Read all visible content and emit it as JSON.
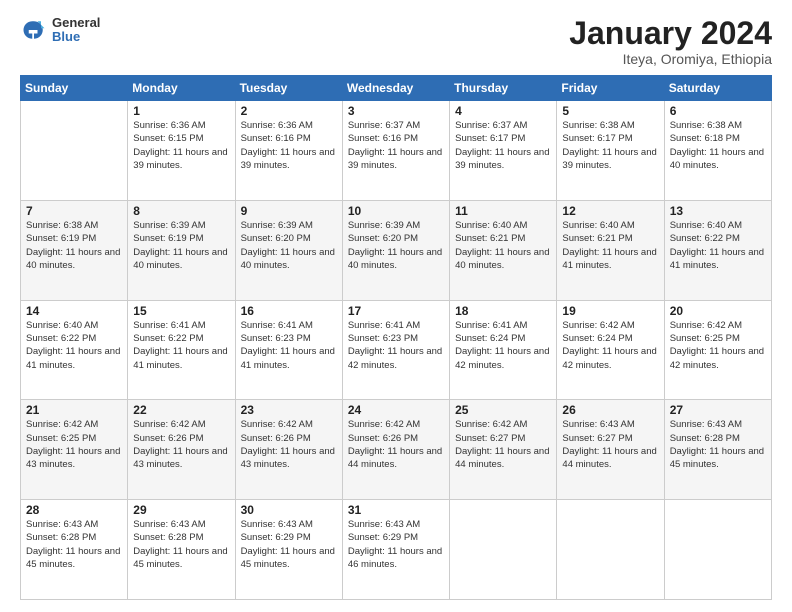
{
  "header": {
    "logo_general": "General",
    "logo_blue": "Blue",
    "month_title": "January 2024",
    "subtitle": "Iteya, Oromiya, Ethiopia"
  },
  "days_of_week": [
    "Sunday",
    "Monday",
    "Tuesday",
    "Wednesday",
    "Thursday",
    "Friday",
    "Saturday"
  ],
  "weeks": [
    [
      {
        "num": "",
        "sunrise": "",
        "sunset": "",
        "daylight": ""
      },
      {
        "num": "1",
        "sunrise": "Sunrise: 6:36 AM",
        "sunset": "Sunset: 6:15 PM",
        "daylight": "Daylight: 11 hours and 39 minutes."
      },
      {
        "num": "2",
        "sunrise": "Sunrise: 6:36 AM",
        "sunset": "Sunset: 6:16 PM",
        "daylight": "Daylight: 11 hours and 39 minutes."
      },
      {
        "num": "3",
        "sunrise": "Sunrise: 6:37 AM",
        "sunset": "Sunset: 6:16 PM",
        "daylight": "Daylight: 11 hours and 39 minutes."
      },
      {
        "num": "4",
        "sunrise": "Sunrise: 6:37 AM",
        "sunset": "Sunset: 6:17 PM",
        "daylight": "Daylight: 11 hours and 39 minutes."
      },
      {
        "num": "5",
        "sunrise": "Sunrise: 6:38 AM",
        "sunset": "Sunset: 6:17 PM",
        "daylight": "Daylight: 11 hours and 39 minutes."
      },
      {
        "num": "6",
        "sunrise": "Sunrise: 6:38 AM",
        "sunset": "Sunset: 6:18 PM",
        "daylight": "Daylight: 11 hours and 40 minutes."
      }
    ],
    [
      {
        "num": "7",
        "sunrise": "Sunrise: 6:38 AM",
        "sunset": "Sunset: 6:19 PM",
        "daylight": "Daylight: 11 hours and 40 minutes."
      },
      {
        "num": "8",
        "sunrise": "Sunrise: 6:39 AM",
        "sunset": "Sunset: 6:19 PM",
        "daylight": "Daylight: 11 hours and 40 minutes."
      },
      {
        "num": "9",
        "sunrise": "Sunrise: 6:39 AM",
        "sunset": "Sunset: 6:20 PM",
        "daylight": "Daylight: 11 hours and 40 minutes."
      },
      {
        "num": "10",
        "sunrise": "Sunrise: 6:39 AM",
        "sunset": "Sunset: 6:20 PM",
        "daylight": "Daylight: 11 hours and 40 minutes."
      },
      {
        "num": "11",
        "sunrise": "Sunrise: 6:40 AM",
        "sunset": "Sunset: 6:21 PM",
        "daylight": "Daylight: 11 hours and 40 minutes."
      },
      {
        "num": "12",
        "sunrise": "Sunrise: 6:40 AM",
        "sunset": "Sunset: 6:21 PM",
        "daylight": "Daylight: 11 hours and 41 minutes."
      },
      {
        "num": "13",
        "sunrise": "Sunrise: 6:40 AM",
        "sunset": "Sunset: 6:22 PM",
        "daylight": "Daylight: 11 hours and 41 minutes."
      }
    ],
    [
      {
        "num": "14",
        "sunrise": "Sunrise: 6:40 AM",
        "sunset": "Sunset: 6:22 PM",
        "daylight": "Daylight: 11 hours and 41 minutes."
      },
      {
        "num": "15",
        "sunrise": "Sunrise: 6:41 AM",
        "sunset": "Sunset: 6:22 PM",
        "daylight": "Daylight: 11 hours and 41 minutes."
      },
      {
        "num": "16",
        "sunrise": "Sunrise: 6:41 AM",
        "sunset": "Sunset: 6:23 PM",
        "daylight": "Daylight: 11 hours and 41 minutes."
      },
      {
        "num": "17",
        "sunrise": "Sunrise: 6:41 AM",
        "sunset": "Sunset: 6:23 PM",
        "daylight": "Daylight: 11 hours and 42 minutes."
      },
      {
        "num": "18",
        "sunrise": "Sunrise: 6:41 AM",
        "sunset": "Sunset: 6:24 PM",
        "daylight": "Daylight: 11 hours and 42 minutes."
      },
      {
        "num": "19",
        "sunrise": "Sunrise: 6:42 AM",
        "sunset": "Sunset: 6:24 PM",
        "daylight": "Daylight: 11 hours and 42 minutes."
      },
      {
        "num": "20",
        "sunrise": "Sunrise: 6:42 AM",
        "sunset": "Sunset: 6:25 PM",
        "daylight": "Daylight: 11 hours and 42 minutes."
      }
    ],
    [
      {
        "num": "21",
        "sunrise": "Sunrise: 6:42 AM",
        "sunset": "Sunset: 6:25 PM",
        "daylight": "Daylight: 11 hours and 43 minutes."
      },
      {
        "num": "22",
        "sunrise": "Sunrise: 6:42 AM",
        "sunset": "Sunset: 6:26 PM",
        "daylight": "Daylight: 11 hours and 43 minutes."
      },
      {
        "num": "23",
        "sunrise": "Sunrise: 6:42 AM",
        "sunset": "Sunset: 6:26 PM",
        "daylight": "Daylight: 11 hours and 43 minutes."
      },
      {
        "num": "24",
        "sunrise": "Sunrise: 6:42 AM",
        "sunset": "Sunset: 6:26 PM",
        "daylight": "Daylight: 11 hours and 44 minutes."
      },
      {
        "num": "25",
        "sunrise": "Sunrise: 6:42 AM",
        "sunset": "Sunset: 6:27 PM",
        "daylight": "Daylight: 11 hours and 44 minutes."
      },
      {
        "num": "26",
        "sunrise": "Sunrise: 6:43 AM",
        "sunset": "Sunset: 6:27 PM",
        "daylight": "Daylight: 11 hours and 44 minutes."
      },
      {
        "num": "27",
        "sunrise": "Sunrise: 6:43 AM",
        "sunset": "Sunset: 6:28 PM",
        "daylight": "Daylight: 11 hours and 45 minutes."
      }
    ],
    [
      {
        "num": "28",
        "sunrise": "Sunrise: 6:43 AM",
        "sunset": "Sunset: 6:28 PM",
        "daylight": "Daylight: 11 hours and 45 minutes."
      },
      {
        "num": "29",
        "sunrise": "Sunrise: 6:43 AM",
        "sunset": "Sunset: 6:28 PM",
        "daylight": "Daylight: 11 hours and 45 minutes."
      },
      {
        "num": "30",
        "sunrise": "Sunrise: 6:43 AM",
        "sunset": "Sunset: 6:29 PM",
        "daylight": "Daylight: 11 hours and 45 minutes."
      },
      {
        "num": "31",
        "sunrise": "Sunrise: 6:43 AM",
        "sunset": "Sunset: 6:29 PM",
        "daylight": "Daylight: 11 hours and 46 minutes."
      },
      {
        "num": "",
        "sunrise": "",
        "sunset": "",
        "daylight": ""
      },
      {
        "num": "",
        "sunrise": "",
        "sunset": "",
        "daylight": ""
      },
      {
        "num": "",
        "sunrise": "",
        "sunset": "",
        "daylight": ""
      }
    ]
  ]
}
